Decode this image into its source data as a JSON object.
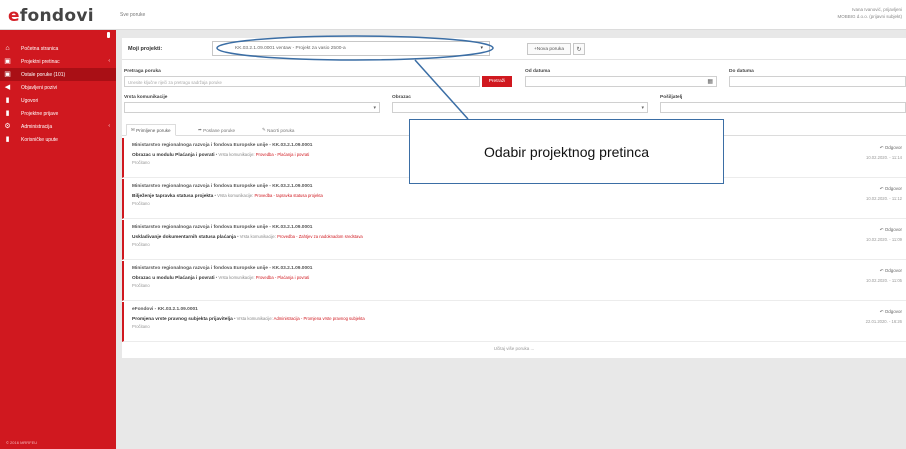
{
  "header": {
    "logo_e": "e",
    "logo_rest": "fondovi",
    "crumb": "Sve poruke",
    "user_line1": "Ivana Ivanović, prijavljeni",
    "user_line2": "MOBBIG d.o.o. (prijavni subjekt)"
  },
  "sidebar": {
    "items": [
      {
        "label": "Početna stranica",
        "icon": "home-icon",
        "glyph": "⌂"
      },
      {
        "label": "Projektni pretinac",
        "icon": "inbox-icon",
        "glyph": "▣",
        "caret": "‹"
      },
      {
        "label": "Ostale poruke (101)",
        "icon": "inbox-icon",
        "glyph": "▣"
      },
      {
        "label": "Objavljeni pozivi",
        "icon": "megaphone-icon",
        "glyph": "◀"
      },
      {
        "label": "Ugovori",
        "icon": "document-icon",
        "glyph": "▮"
      },
      {
        "label": "Projektne prijave",
        "icon": "document-icon",
        "glyph": "▮"
      },
      {
        "label": "Administracija",
        "icon": "gears-icon",
        "glyph": "⚙",
        "caret": "‹"
      },
      {
        "label": "Korisničke upute",
        "icon": "document-icon",
        "glyph": "▮"
      }
    ],
    "footer": "© 2016 MRRFEU"
  },
  "project": {
    "label": "Moji projekti:",
    "selected": "KK.03.2.1.09.0001 ventaw - Projekt za vasio 2500-a",
    "new_message": "Nova poruka",
    "refresh_glyph": "↻"
  },
  "filters": {
    "search_label": "Pretraga poruka",
    "search_placeholder": "Unesite ključne riječi za pretragu sadržaja poruke",
    "search_button": "Pretraži",
    "from_label": "Od datuma",
    "to_label": "Do datuma",
    "type_label": "Vrsta komunikacije",
    "subject_label": "Obrazac",
    "sender_label": "Pošiljatelj"
  },
  "tabs": [
    {
      "label": "Primljene poruke"
    },
    {
      "label": "Poslane poruke"
    },
    {
      "label": "Nacrti poruka"
    }
  ],
  "messages": [
    {
      "from": "Ministarstvo regionalnoga razvoja i fondova Europske unije - KK.03.2.1.09.0001",
      "subject": "Obrazac u modulu Plaćanja i povrati",
      "meta": " • Vrsta komunikacije: ",
      "category": "Provedba - Plaćanja i povrati",
      "status": "Pročitano",
      "reply": "Odgovor",
      "date": "10.02.2020. - 11:14"
    },
    {
      "from": "Ministarstvo regionalnoga razvoja i fondova Europske unije - KK.03.2.1.09.0001",
      "subject": "Bilježenje tapravka statusa projekta",
      "meta": " • Vrsta komunikacije: ",
      "category": "Provedba - tapravka statusa projekta",
      "status": "Pročitano",
      "reply": "Odgovor",
      "date": "10.02.2020. - 11:12"
    },
    {
      "from": "Ministarstvo regionalnoga razvoja i fondova Europske unije - KK.03.2.1.09.0001",
      "subject": "Uskladivanje dokumentarnih statusa plaćanja",
      "meta": " • Vrsta komunikacije: ",
      "category": "Provedba - Zahtjev za nadoknadom sredstava",
      "status": "Pročitano",
      "reply": "Odgovor",
      "date": "10.02.2020. - 11:09"
    },
    {
      "from": "Ministarstvo regionalnoga razvoja i fondova Europske unije - KK.03.2.1.09.0001",
      "subject": "Obrazac u modulu Plaćanja i povrati",
      "meta": " • Vrsta komunikacije: ",
      "category": "Provedba - Plaćanja i povrati",
      "status": "Pročitano",
      "reply": "Odgovor",
      "date": "10.02.2020. - 11:05"
    },
    {
      "from": "eFondovi - KK.03.2.1.09.0001",
      "subject": "Promjena vrste pravnog subjekta prijavitelja",
      "meta": " • Vrsta komunikacije: ",
      "category": "Administracija - Promjena vrste pravnog subjekta",
      "status": "Pročitano",
      "reply": "Odgovor",
      "date": "22.01.2020. - 16:26"
    }
  ],
  "more": "Učitaj više poruka ...",
  "callout": {
    "text": "Odabir projektnog pretinca",
    "color": "#3b6ea5"
  }
}
